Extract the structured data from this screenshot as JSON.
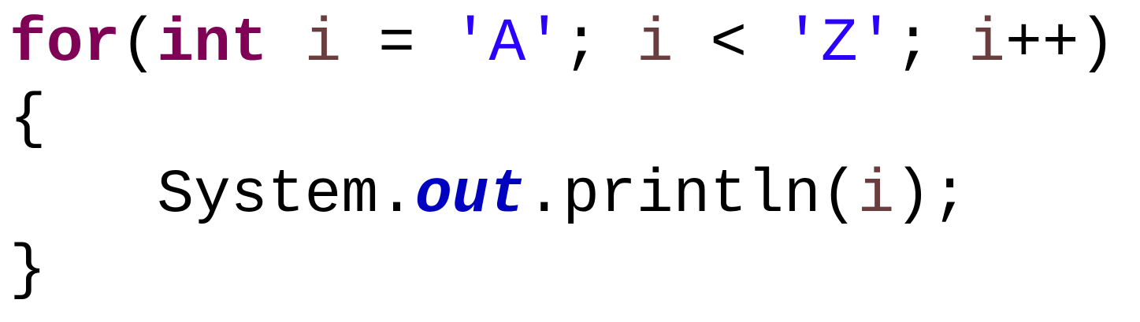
{
  "code": {
    "line1": {
      "kw_for": "for",
      "p_open": "(",
      "kw_int": "int",
      "sp1": " ",
      "var1": "i",
      "op_assign": " = ",
      "lit_a": "'A'",
      "semi1": "; ",
      "var2": "i",
      "op_lt": " < ",
      "lit_z": "'Z'",
      "semi2": "; ",
      "var3": "i",
      "op_inc": "++)"
    },
    "line2": {
      "brace_open": "{"
    },
    "line3": {
      "indent": "    ",
      "cls_system": "System.",
      "fld_out": "out",
      "meth": ".println(",
      "var4": "i",
      "end": ");"
    },
    "line4": {
      "brace_close": "}"
    }
  },
  "colors": {
    "keyword": "#7f0055",
    "variable": "#6a3e3e",
    "char_literal": "#2a00ff",
    "static_field": "#0000c0",
    "plain": "#000000",
    "background": "#ffffff"
  }
}
